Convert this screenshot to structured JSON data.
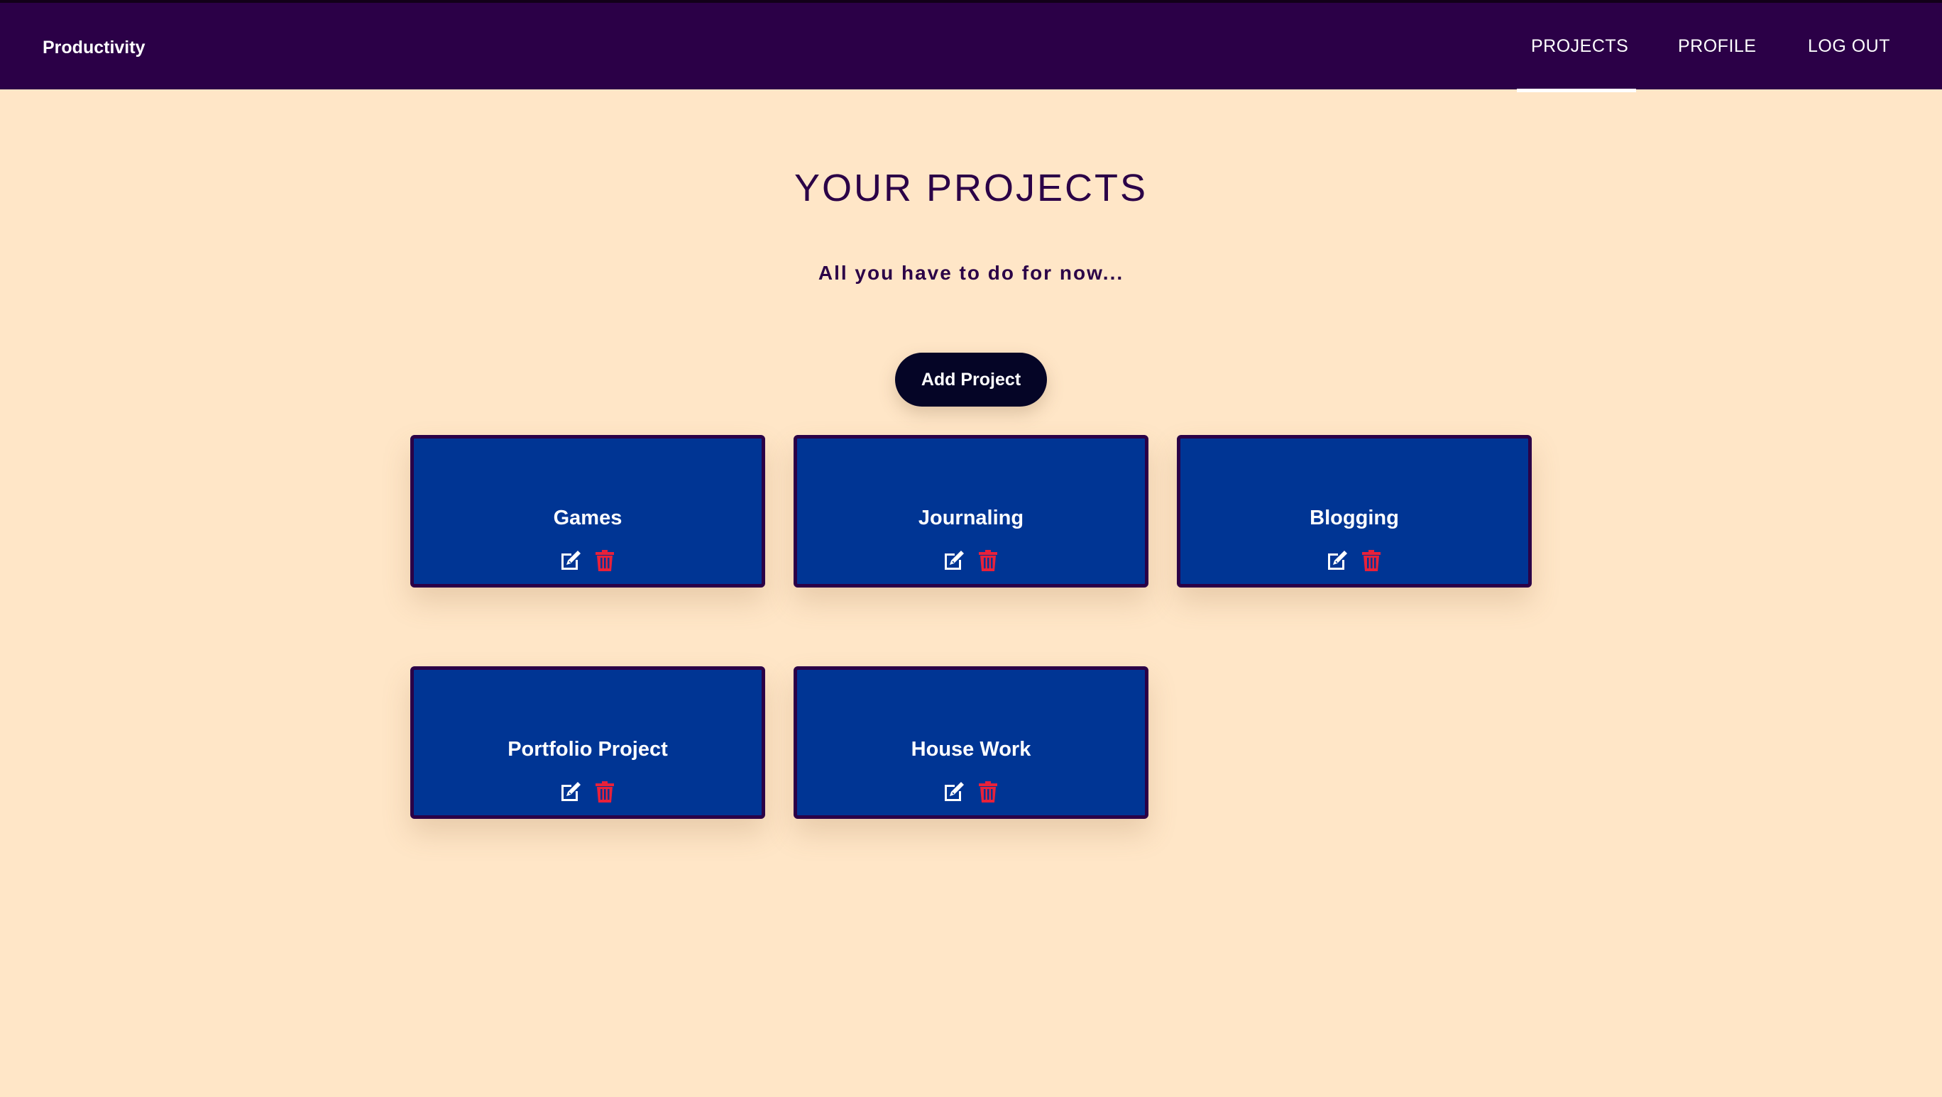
{
  "header": {
    "brand": "Productivity",
    "nav": {
      "projects": "PROJECTS",
      "profile": "PROFILE",
      "logout": "LOG OUT"
    },
    "active_nav": "PROJECTS"
  },
  "main": {
    "title": "YOUR PROJECTS",
    "subtitle": "All you have to do for now...",
    "add_button": "Add Project",
    "projects": [
      {
        "name": "Games"
      },
      {
        "name": "Journaling"
      },
      {
        "name": "Blogging"
      },
      {
        "name": "Portfolio Project"
      },
      {
        "name": "House Work"
      }
    ]
  },
  "icons": {
    "edit": "edit-icon",
    "delete": "trash-icon"
  },
  "colors": {
    "navbar": "#2b0047",
    "background": "#ffe6c7",
    "card": "#003594",
    "card_border": "#2b0047",
    "button": "#050526",
    "delete_icon": "#e8213a",
    "edit_icon": "#ffffff"
  }
}
